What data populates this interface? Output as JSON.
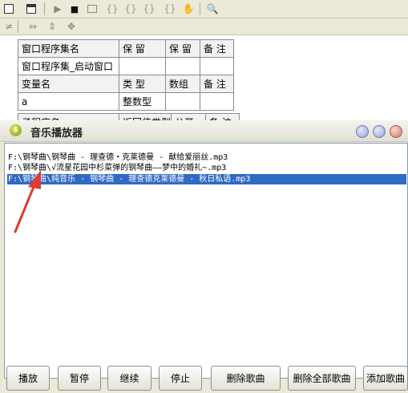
{
  "toolbar": {
    "row1_icons": [
      "window-icon",
      "layout-icon",
      "run-icon",
      "stop-icon",
      "step-into-icon",
      "step-over-icon",
      "step-out-icon",
      "run-to-cursor-icon",
      "breakpoint-icon",
      "hand-icon",
      "find-icon"
    ],
    "row2_icons": [
      "align-icon",
      "size-width-icon",
      "size-height-icon",
      "size-both-icon"
    ]
  },
  "editor_table": {
    "rows": [
      [
        "窗口程序集名",
        "保 留",
        "保 留",
        "备 注"
      ],
      [
        "窗口程序集_启动窗口",
        "",
        "",
        ""
      ],
      [
        "变量名",
        "类 型",
        "数组",
        "备 注"
      ],
      [
        "a",
        "整数型",
        "",
        ""
      ]
    ],
    "partial_row": [
      "子程序名",
      "返回值类型",
      "公开",
      "备 注"
    ]
  },
  "player": {
    "title": "音乐播放器",
    "playlist": [
      "F:\\钢琴曲\\钢琴曲 - 理查德・克莱德曼 - 献给爱丽丝.mp3",
      "F:\\钢琴曲\\√流星花园中杉菜弹的钢琴曲——梦中的婚礼~.mp3",
      "F:\\钢琴曲\\纯音乐 - 钢琴曲 - 理查德克莱德曼 - 秋日私语.mp3"
    ],
    "selected_index": 2,
    "buttons": {
      "play": "播放",
      "pause": "暂停",
      "resume": "继续",
      "stop": "停止",
      "delete_song": "删除歌曲",
      "delete_all": "删除全部歌曲",
      "add_song": "添加歌曲"
    }
  },
  "colors": {
    "selection": "#316ac5",
    "annotation_arrow": "#e03a2e",
    "chrome": "#ece9d8"
  }
}
